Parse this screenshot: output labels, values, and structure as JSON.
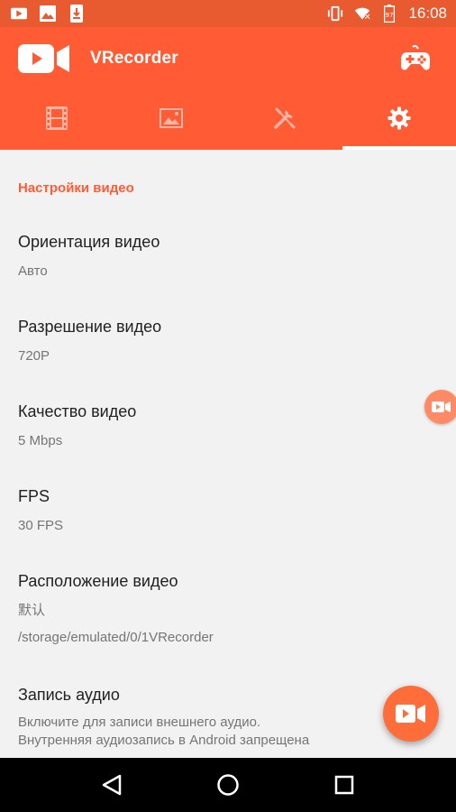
{
  "status_bar": {
    "time": "16:08",
    "icons_left": [
      "video-notification-icon",
      "image-notification-icon",
      "download-notification-icon"
    ],
    "icons_right": [
      "vibrate-icon",
      "wifi-icon",
      "battery-icon"
    ]
  },
  "app_bar": {
    "title": "VRecorder",
    "logo_icon": "camera-logo-icon",
    "action_icon": "gamepad-icon"
  },
  "tabs": [
    {
      "icon": "film-icon",
      "active": false
    },
    {
      "icon": "image-icon",
      "active": false
    },
    {
      "icon": "tools-icon",
      "active": false
    },
    {
      "icon": "gear-icon",
      "active": true
    }
  ],
  "settings": {
    "section_title": "Настройки видео",
    "items": [
      {
        "title": "Ориентация видео",
        "subtitle": "Авто"
      },
      {
        "title": "Разрешение видео",
        "subtitle": "720P"
      },
      {
        "title": "Качество видео",
        "subtitle": "5 Mbps"
      },
      {
        "title": "FPS",
        "subtitle": "30 FPS"
      },
      {
        "title": "Расположение видео",
        "subtitle": "默认",
        "subtitle2": "/storage/emulated/0/1VRecorder"
      },
      {
        "title": "Запись аудио",
        "subtitle": "Включите для записи внешнего аудио.",
        "subtitle2": "Внутренняя аудиозапись в Android запрещена"
      }
    ]
  },
  "colors": {
    "accent": "#ff5c35",
    "status_bar": "#e85a2f",
    "background": "#f2f2f2"
  },
  "nav_bar": [
    "back-icon",
    "home-icon",
    "recents-icon"
  ]
}
